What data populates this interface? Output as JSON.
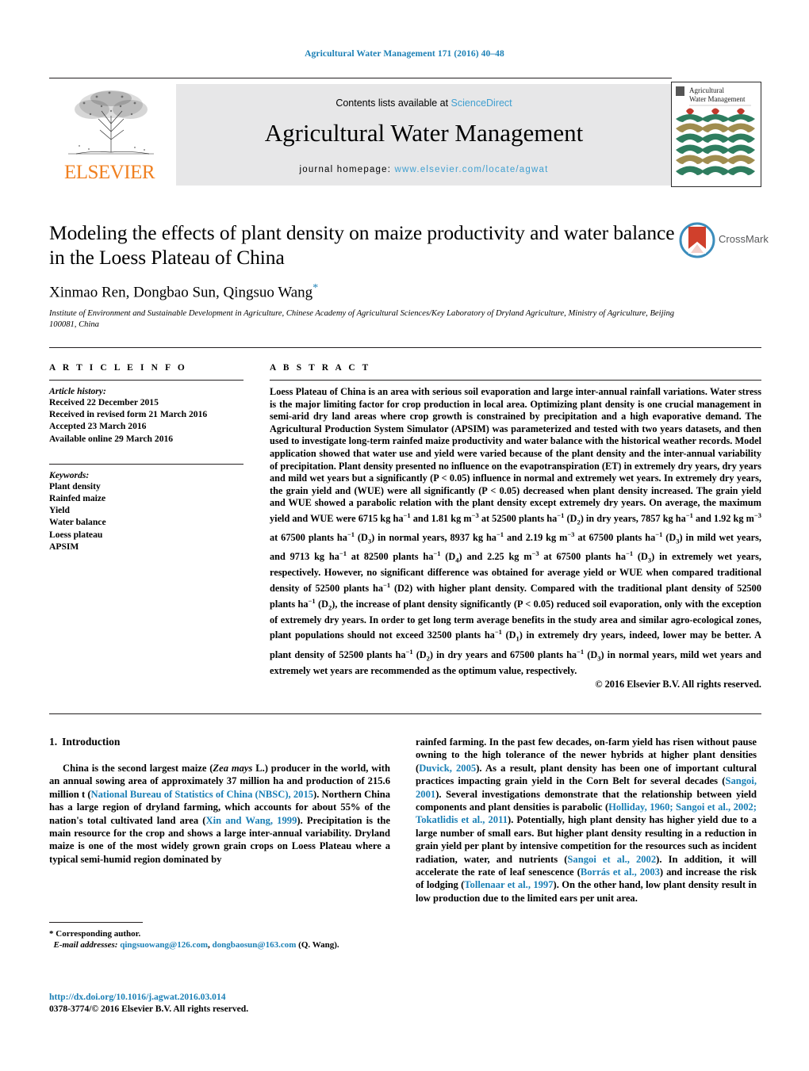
{
  "running_head": "Agricultural Water Management 171 (2016) 40–48",
  "masthead": {
    "contents_prefix": "Contents lists available at ",
    "sciencedirect": "ScienceDirect",
    "journal_name": "Agricultural Water Management",
    "homepage_prefix": "journal homepage: ",
    "homepage_url": "www.elsevier.com/locate/agwat",
    "publisher": "ELSEVIER",
    "cover_title_line1": "Agricultural",
    "cover_title_line2": "Water Management",
    "link_color": "#3f9fd0",
    "elsevier_color": "#f08020"
  },
  "article": {
    "title": "Modeling the effects of plant density on maize productivity and water balance in the Loess Plateau of China",
    "authors": "Xinmao Ren, Dongbao Sun, Qingsuo Wang",
    "corresponding_marker": "*",
    "affiliation": "Institute of Environment and Sustainable Development in Agriculture, Chinese Academy of Agricultural Sciences/Key Laboratory of Dryland Agriculture, Ministry of Agriculture, Beijing 100081, China",
    "crossmark_label": "CrossMark"
  },
  "article_info": {
    "heading": "A R T I C L E   I N F O",
    "history_title": "Article history:",
    "history": [
      "Received 22 December 2015",
      "Received in revised form 21 March 2016",
      "Accepted 23 March 2016",
      "Available online 29 March 2016"
    ],
    "keywords_title": "Keywords:",
    "keywords": [
      "Plant density",
      "Rainfed maize",
      "Yield",
      "Water balance",
      "Loess plateau",
      "APSIM"
    ]
  },
  "abstract": {
    "heading": "A B S T R A C T",
    "p1": "Loess Plateau of China is an area with serious soil evaporation and large inter-annual rainfall variations. Water stress is the major limiting factor for crop production in local area. Optimizing plant density is one crucial management in semi-arid dry land areas where crop growth is constrained by precipitation and a high evaporative demand. The Agricultural Production System Simulator (APSIM) was parameterized and tested with two years datasets, and then used to investigate long-term rainfed maize productivity and water balance with the historical weather records. Model application showed that water use and yield were varied because of the plant density and the inter-annual variability of precipitation. Plant density presented no influence on the evapotranspiration (ET) in extremely dry years, dry years and mild wet years but a significantly (P < 0.05) influence in normal and extremely wet years. In extremely dry years, the grain yield and (WUE) were all significantly (P < 0.05) decreased when plant density increased. The grain yield and WUE showed a parabolic relation with the plant density except extremely dry years. On average,",
    "copyright": "© 2016 Elsevier B.V. All rights reserved."
  },
  "introduction": {
    "number": "1.",
    "heading": "Introduction",
    "left_p1": "China is the second largest maize (Zea mays L.) producer in the world, with an annual sowing area of approximately 37 million ha and production of 215.6 million t (National Bureau of Statistics of China (NBSC), 2015). Northern China has a large region of dryland farming, which accounts for about 55% of the nation's total cultivated land area (Xin and Wang, 1999). Precipitation is the main resource for the crop and shows a large inter-annual variability. Dryland maize is one of the most widely grown grain crops on Loess Plateau where a typical semi-humid region dominated by"
  },
  "footnote": {
    "corresponding": "* Corresponding author.",
    "email_label": "E-mail addresses:",
    "email1": "qingsuowang@126.com",
    "email2": "dongbaosun@163.com",
    "email_suffix": "(Q. Wang)."
  },
  "doi": {
    "url": "http://dx.doi.org/10.1016/j.agwat.2016.03.014",
    "issn_line": "0378-3774/© 2016 Elsevier B.V. All rights reserved."
  }
}
